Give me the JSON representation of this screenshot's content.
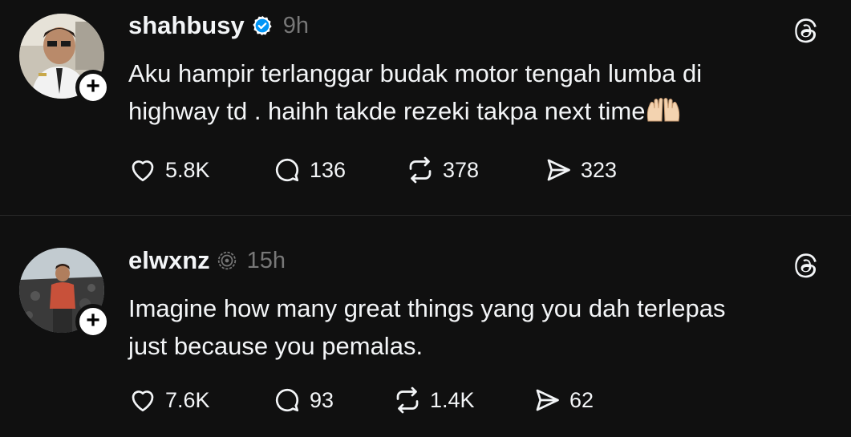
{
  "posts": [
    {
      "username": "shahbusy",
      "verified": true,
      "time": "9h",
      "text_line1": "Aku hampir terlanggar budak motor tengah lumba di",
      "text_line2": "highway td . haihh takde rezeki takpa next time",
      "emoji": "raising-hands",
      "likes": "5.8K",
      "replies": "136",
      "reposts": "378",
      "shares": "323"
    },
    {
      "username": "elwxnz",
      "verified": false,
      "time": "15h",
      "text_line1": "Imagine how many great things yang you dah terlepas",
      "text_line2": "just because you pemalas.",
      "likes": "7.6K",
      "replies": "93",
      "reposts": "1.4K",
      "shares": "62"
    }
  ],
  "colors": {
    "background": "#101010",
    "text": "#f3f5f7",
    "muted": "#777777",
    "verified": "#0095f6"
  },
  "icons": [
    "heart-icon",
    "reply-icon",
    "repost-icon",
    "share-icon",
    "threads-icon",
    "plus-icon",
    "verified-icon"
  ]
}
